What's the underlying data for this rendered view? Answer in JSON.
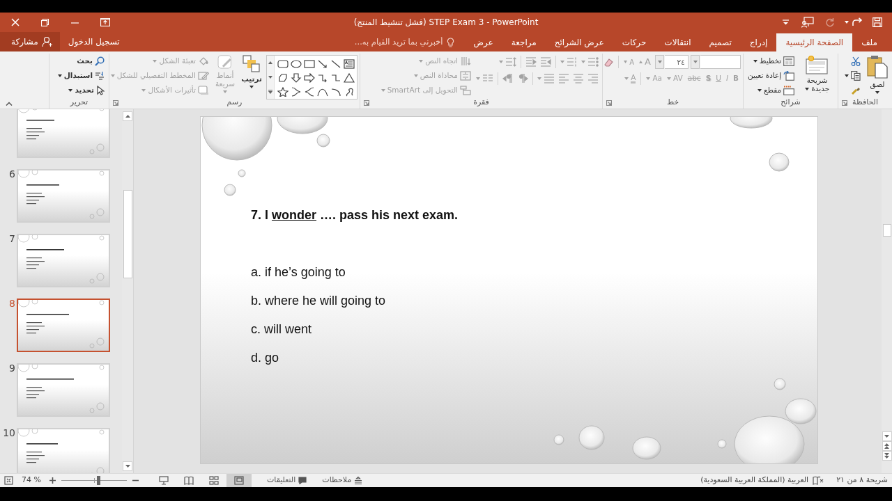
{
  "title_bar": {
    "title": "STEP Exam 3 - PowerPoint (فشل تنشيط المنتج)",
    "quick_access": [
      {
        "kind": "save",
        "disabled": false
      },
      {
        "kind": "undo",
        "disabled": false
      },
      {
        "kind": "repeat",
        "disabled": true
      },
      {
        "kind": "present",
        "disabled": false
      },
      {
        "kind": "customize",
        "disabled": false
      }
    ]
  },
  "tabs": [
    {
      "label": "ملف",
      "selected": false
    },
    {
      "label": "الصفحة الرئيسية",
      "selected": true
    },
    {
      "label": "إدراج",
      "selected": false
    },
    {
      "label": "تصميم",
      "selected": false
    },
    {
      "label": "انتقالات",
      "selected": false
    },
    {
      "label": "حركات",
      "selected": false
    },
    {
      "label": "عرض الشرائح",
      "selected": false
    },
    {
      "label": "مراجعة",
      "selected": false
    },
    {
      "label": "عرض",
      "selected": false
    }
  ],
  "tell_me": {
    "placeholder": "أخبرني بما تريد القيام به..."
  },
  "account": {
    "sign_in": "تسجيل الدخول",
    "share": "مشاركة"
  },
  "ribbon": [
    {
      "kind": "clipboard",
      "label": "الحافظة",
      "paste": "لصق"
    },
    {
      "kind": "slides",
      "label": "شرائح",
      "new_slide": "شريحة جديدة",
      "layout": "تخطيط",
      "reset": "إعادة تعيين",
      "section": "مقطع"
    },
    {
      "kind": "font",
      "label": "خط",
      "disabled": true,
      "font_size": "٢٤",
      "grow": "A",
      "shrink": "A",
      "formats": [
        "B",
        "I",
        "U",
        "S",
        "abc",
        "AV",
        "Aa",
        "A"
      ]
    },
    {
      "kind": "paragraph",
      "label": "فقرة",
      "disabled": true,
      "text_direction": "اتجاه النص",
      "align_text": "محاذاة النص",
      "smartart": "التحويل إلى SmartArt"
    },
    {
      "kind": "drawing",
      "label": "رسم",
      "styles_disabled": true,
      "arrange": "ترتيب",
      "quick_styles": "أنماط سريعة",
      "shape_fill": "تعبئة الشكل",
      "shape_outline": "المخطط التفصيلي للشكل",
      "shape_effects": "تأثيرات الأشكال"
    },
    {
      "kind": "editing",
      "label": "تحرير",
      "find": "بحث",
      "replace": "استبدال",
      "select": "تحديد"
    }
  ],
  "slide_panel": {
    "thumbnails": [
      {
        "selected": false
      },
      {
        "number": "6",
        "selected": false
      },
      {
        "number": "7",
        "selected": false
      },
      {
        "number": "8",
        "selected": true
      },
      {
        "number": "9",
        "selected": false
      },
      {
        "number": "10",
        "selected": false
      }
    ]
  },
  "slide": {
    "question": {
      "number": "7. I",
      "underlined": "wonder",
      "rest": "…. pass his next exam."
    },
    "options": [
      "a. if he’s going to",
      "b. where he will going to",
      "c. will went",
      "d. go"
    ]
  },
  "status_bar": {
    "zoom_reading": "74 %",
    "views": [
      {
        "kind": "slideshow",
        "selected": false
      },
      {
        "kind": "reading",
        "selected": false
      },
      {
        "kind": "sorter",
        "selected": false
      },
      {
        "kind": "normal",
        "selected": true
      }
    ],
    "comments": "التعليقات",
    "notes": "ملاحظات",
    "language": "العربية (المملكة العربية السعودية)",
    "slide_info": "شريحة ٨ من ٢١"
  }
}
